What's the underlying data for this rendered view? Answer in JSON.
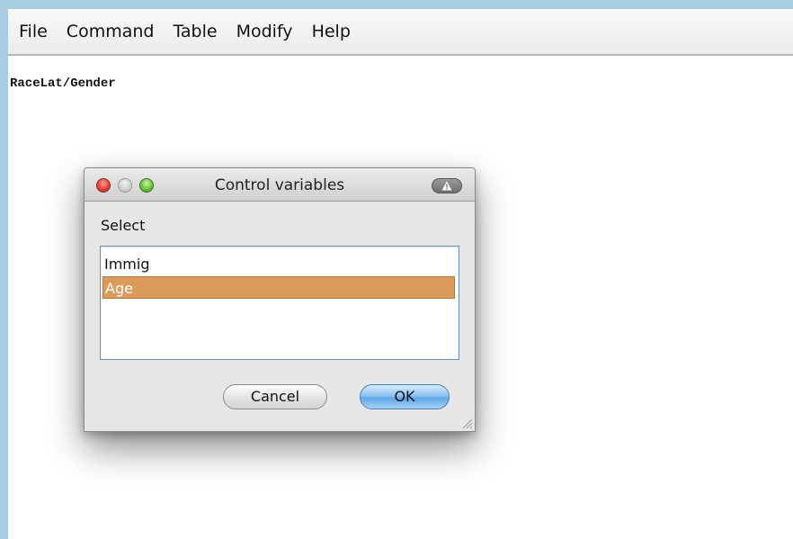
{
  "menu": {
    "items": [
      "File",
      "Command",
      "Table",
      "Modify",
      "Help"
    ]
  },
  "document": {
    "text": "RaceLat/Gender"
  },
  "dialog": {
    "title": "Control variables",
    "select_label": "Select",
    "list_items": [
      "Immig",
      "Age"
    ],
    "selected_item": "Age",
    "cancel_label": "Cancel",
    "ok_label": "OK"
  },
  "colors": {
    "selection": "#dc9a5b",
    "ok_button": "#5fa6e6",
    "background": "#a9cde3"
  },
  "icons": [
    "close-icon",
    "minimize-icon",
    "zoom-icon",
    "warning-icon",
    "resize-grip-icon"
  ]
}
